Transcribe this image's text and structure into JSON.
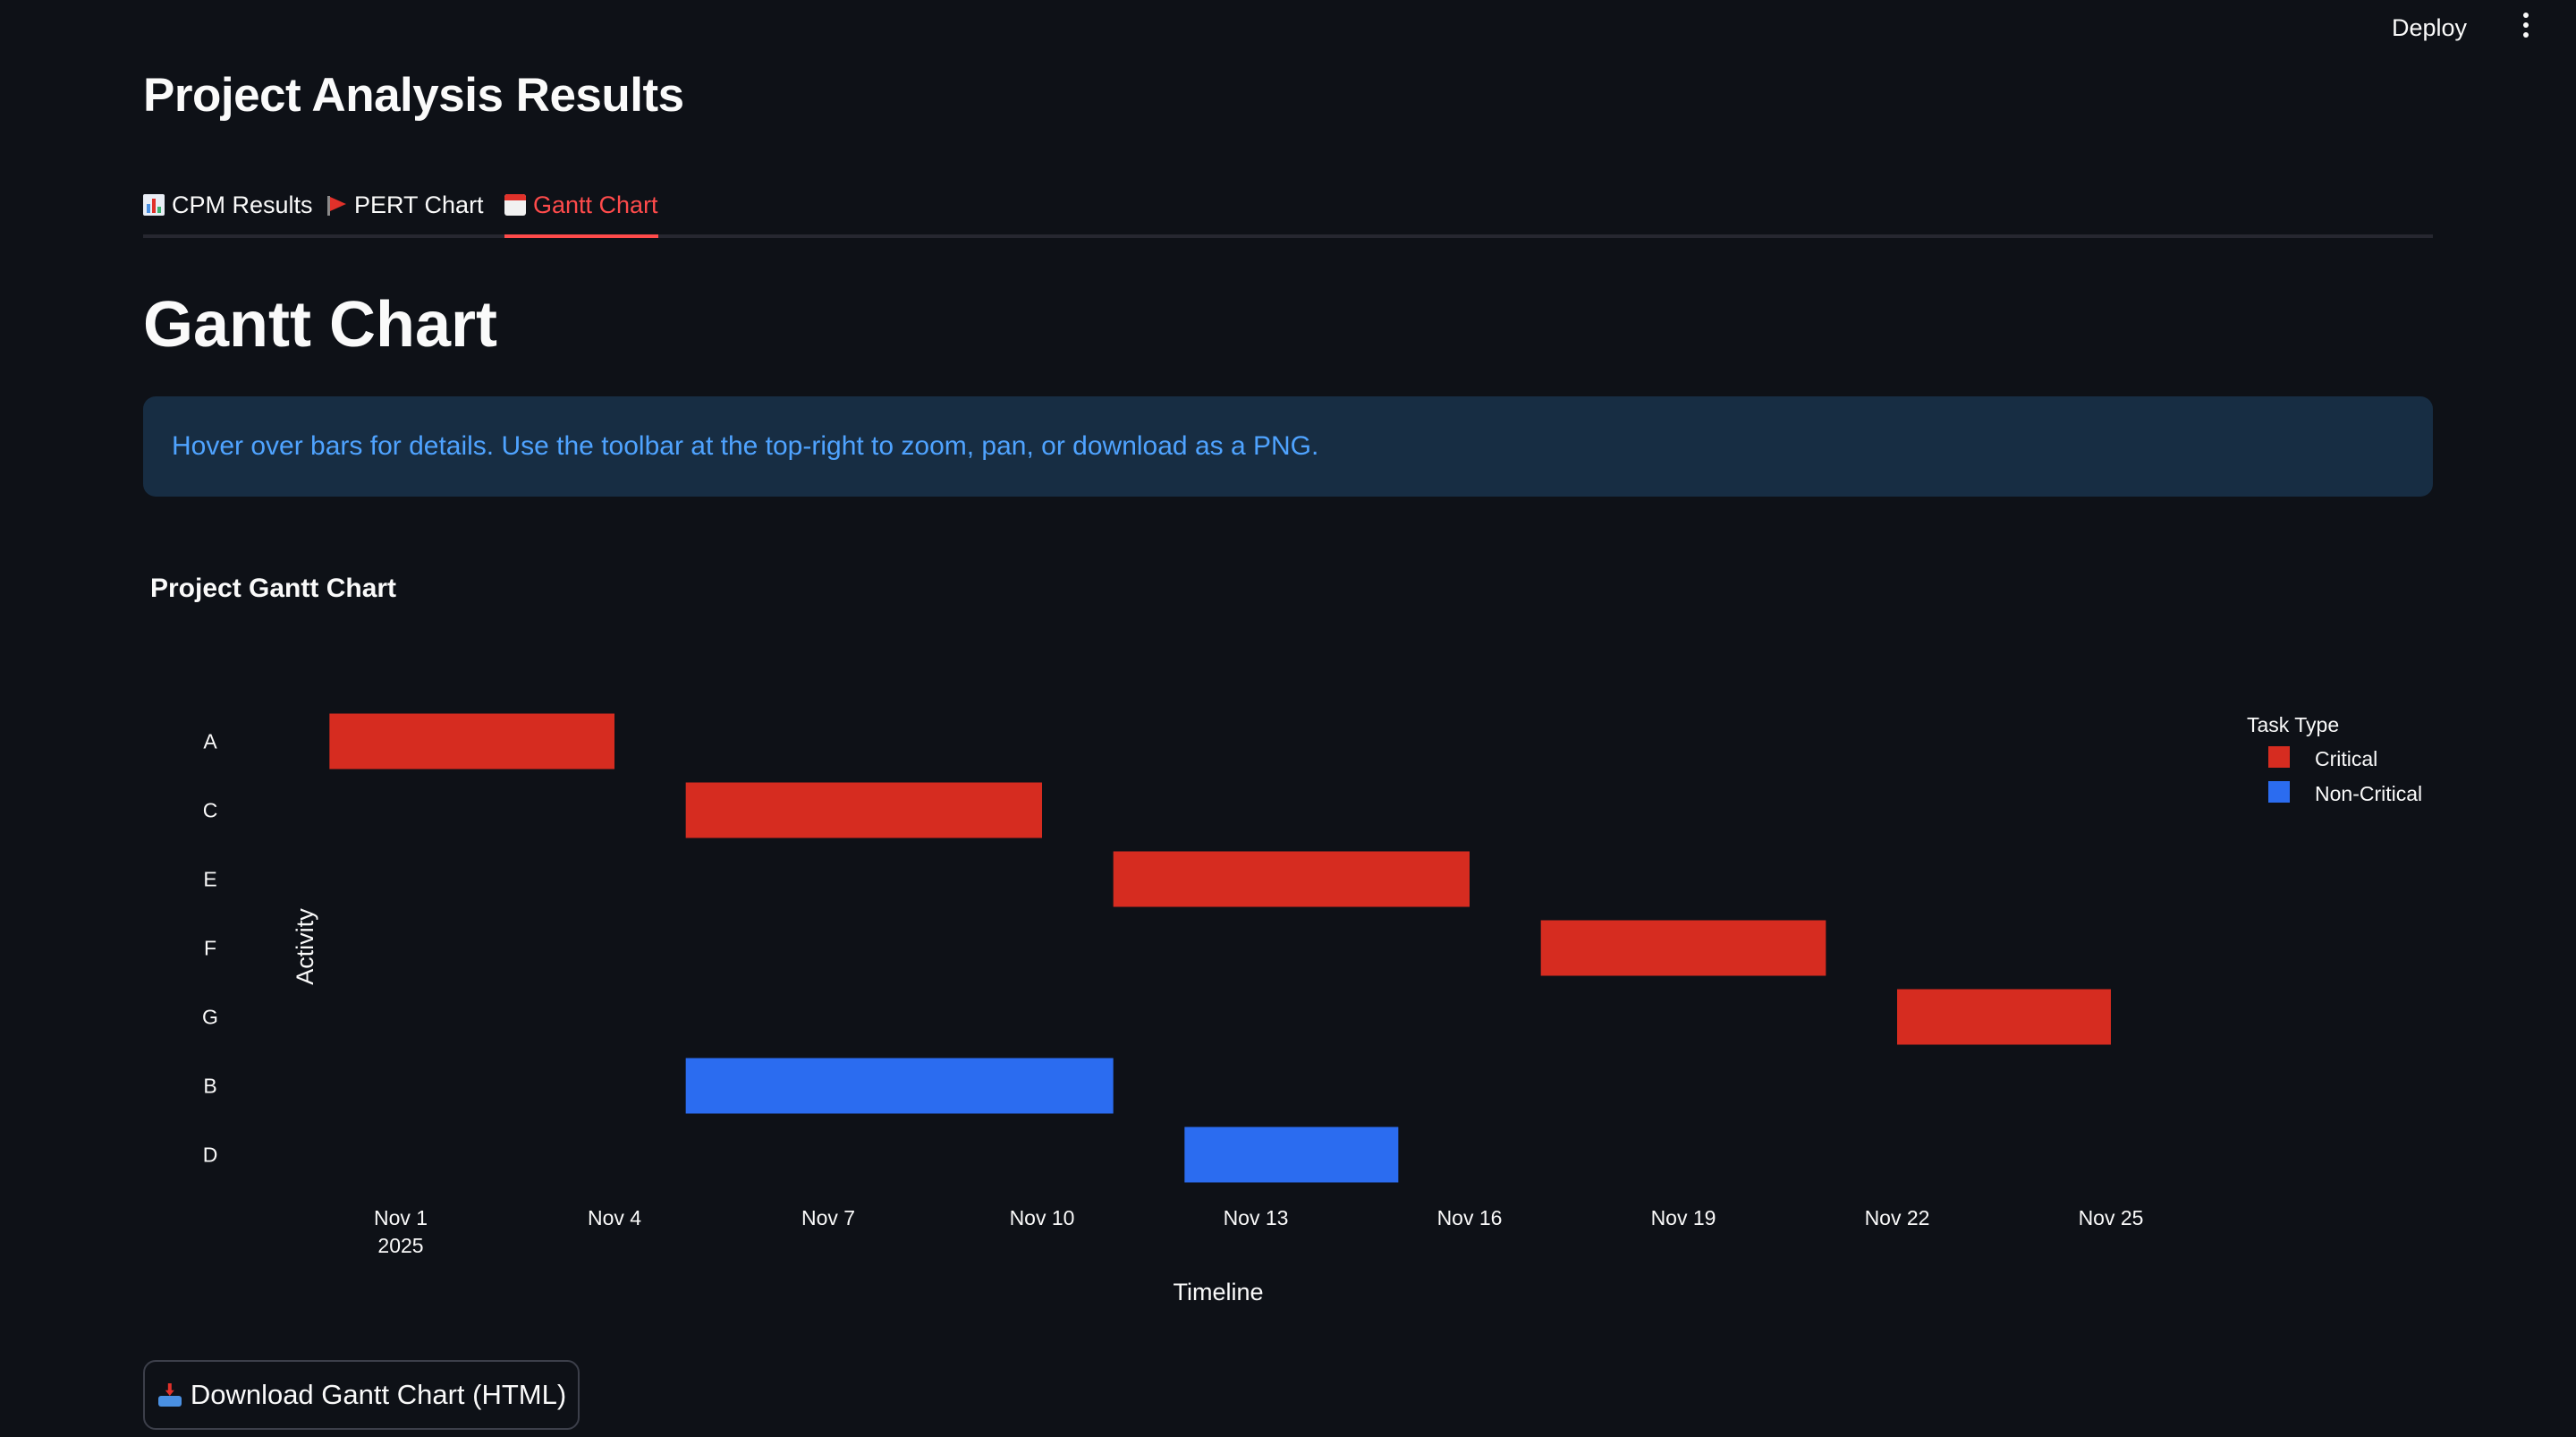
{
  "header": {
    "deploy_label": "Deploy",
    "menu_icon": "kebab-menu-icon"
  },
  "page": {
    "title": "Project Analysis Results",
    "tabs": [
      {
        "label": "CPM Results",
        "icon": "bar-chart-icon",
        "active": false
      },
      {
        "label": "PERT Chart",
        "icon": "flag-icon",
        "active": false
      },
      {
        "label": "Gantt Chart",
        "icon": "calendar-icon",
        "active": true
      }
    ],
    "section_title": "Gantt Chart",
    "info": "Hover over bars for details. Use the toolbar at the top-right to zoom, pan, or download as a PNG.",
    "download_label": "Download Gantt Chart (HTML)",
    "download_icon": "outbox-tray-icon"
  },
  "colors": {
    "background": "#0e1117",
    "accent": "#ff4b4b",
    "critical": "#d62c20",
    "non_critical": "#2b6cf0",
    "info_bg": "#172d43",
    "info_text": "#4fa3ff"
  },
  "chart_data": {
    "type": "gantt",
    "title": "Project Gantt Chart",
    "xlabel": "Timeline",
    "ylabel": "Activity",
    "x_range": [
      "2025-10-30",
      "2025-11-28"
    ],
    "x_ticks": [
      {
        "date": "2025-11-01",
        "label": "Nov 1",
        "sublabel": "2025"
      },
      {
        "date": "2025-11-04",
        "label": "Nov 4"
      },
      {
        "date": "2025-11-07",
        "label": "Nov 7"
      },
      {
        "date": "2025-11-10",
        "label": "Nov 10"
      },
      {
        "date": "2025-11-13",
        "label": "Nov 13"
      },
      {
        "date": "2025-11-16",
        "label": "Nov 16"
      },
      {
        "date": "2025-11-19",
        "label": "Nov 19"
      },
      {
        "date": "2025-11-22",
        "label": "Nov 22"
      },
      {
        "date": "2025-11-25",
        "label": "Nov 25"
      }
    ],
    "categories": [
      "A",
      "C",
      "E",
      "F",
      "G",
      "B",
      "D"
    ],
    "legend": {
      "title": "Task Type",
      "position": "top-right",
      "entries": [
        "Critical",
        "Non-Critical"
      ]
    },
    "grid": false,
    "tasks": [
      {
        "activity": "A",
        "start": "2025-11-00",
        "end": "2025-11-04",
        "type": "Critical"
      },
      {
        "activity": "C",
        "start": "2025-11-05",
        "end": "2025-11-10",
        "type": "Critical"
      },
      {
        "activity": "E",
        "start": "2025-11-11",
        "end": "2025-11-16",
        "type": "Critical"
      },
      {
        "activity": "F",
        "start": "2025-11-17",
        "end": "2025-11-21",
        "type": "Critical"
      },
      {
        "activity": "G",
        "start": "2025-11-22",
        "end": "2025-11-25",
        "type": "Critical"
      },
      {
        "activity": "B",
        "start": "2025-11-05",
        "end": "2025-11-11",
        "type": "Non-Critical"
      },
      {
        "activity": "D",
        "start": "2025-11-12",
        "end": "2025-11-15",
        "type": "Non-Critical"
      }
    ]
  }
}
